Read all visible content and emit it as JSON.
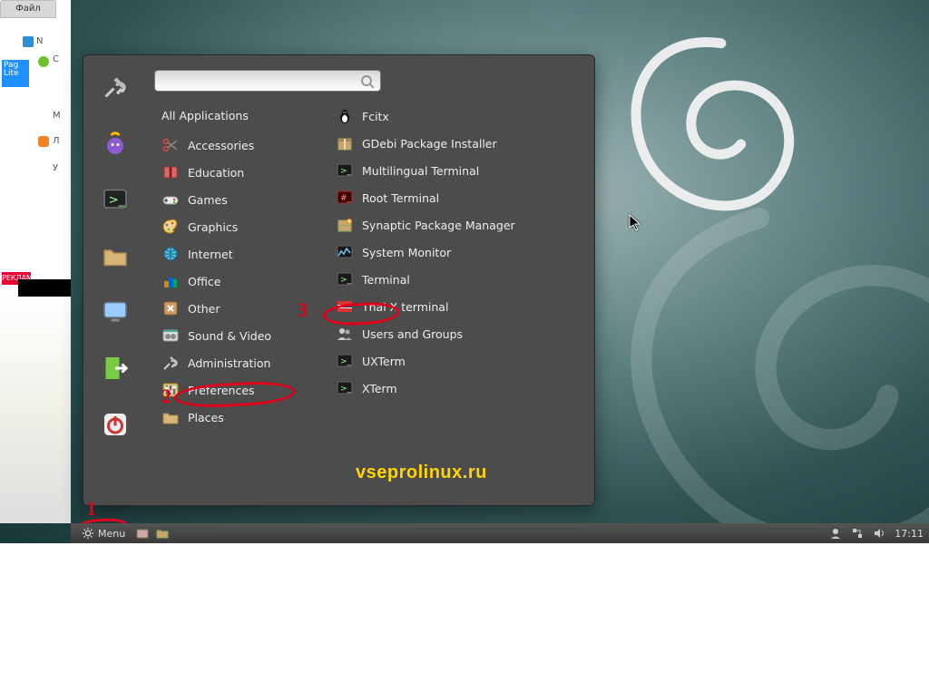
{
  "annotations": {
    "one": "1",
    "two": "2",
    "three": "3"
  },
  "watermark": "vseprolinux.ru",
  "clock": "17:11",
  "panel": {
    "menu_label": "Menu"
  },
  "leftnoise": {
    "tab": "Файл",
    "r1": "N",
    "r2": "C",
    "r3": "M",
    "r4": "Л",
    "r5": "У",
    "pag": "Pag\nLite"
  },
  "menu": {
    "all_applications": "All Applications",
    "search_placeholder": "",
    "categories": [
      {
        "id": "accessories",
        "label": "Accessories",
        "icon": "scissors"
      },
      {
        "id": "education",
        "label": "Education",
        "icon": "book"
      },
      {
        "id": "games",
        "label": "Games",
        "icon": "games"
      },
      {
        "id": "graphics",
        "label": "Graphics",
        "icon": "palette"
      },
      {
        "id": "internet",
        "label": "Internet",
        "icon": "globe"
      },
      {
        "id": "office",
        "label": "Office",
        "icon": "office"
      },
      {
        "id": "other",
        "label": "Other",
        "icon": "other"
      },
      {
        "id": "sound-video",
        "label": "Sound & Video",
        "icon": "media"
      },
      {
        "id": "administration",
        "label": "Administration",
        "icon": "tools"
      },
      {
        "id": "preferences",
        "label": "Preferences",
        "icon": "prefs"
      },
      {
        "id": "places",
        "label": "Places",
        "icon": "folder"
      }
    ],
    "apps": [
      {
        "id": "fcitx",
        "label": "Fcitx",
        "icon": "penguin"
      },
      {
        "id": "gdebi",
        "label": "GDebi Package Installer",
        "icon": "package"
      },
      {
        "id": "mlterm",
        "label": "Multilingual Terminal",
        "icon": "term"
      },
      {
        "id": "rootterm",
        "label": "Root Terminal",
        "icon": "rootterm"
      },
      {
        "id": "synaptic",
        "label": "Synaptic Package Manager",
        "icon": "synaptic"
      },
      {
        "id": "sysmon",
        "label": "System Monitor",
        "icon": "sysmon"
      },
      {
        "id": "terminal",
        "label": "Terminal",
        "icon": "term"
      },
      {
        "id": "thaix",
        "label": "Thai X terminal",
        "icon": "thai"
      },
      {
        "id": "users",
        "label": "Users and Groups",
        "icon": "users"
      },
      {
        "id": "uxterm",
        "label": "UXTerm",
        "icon": "term"
      },
      {
        "id": "xterm",
        "label": "XTerm",
        "icon": "term"
      }
    ],
    "favorites": [
      {
        "id": "settings",
        "icon": "tools"
      },
      {
        "id": "pidgin",
        "icon": "pidgin"
      },
      {
        "id": "terminal",
        "icon": "termfav"
      },
      {
        "id": "files",
        "icon": "folder"
      },
      {
        "id": "display",
        "icon": "monitor"
      },
      {
        "id": "logout",
        "icon": "logout"
      },
      {
        "id": "shutdown",
        "icon": "shutdown"
      }
    ]
  }
}
